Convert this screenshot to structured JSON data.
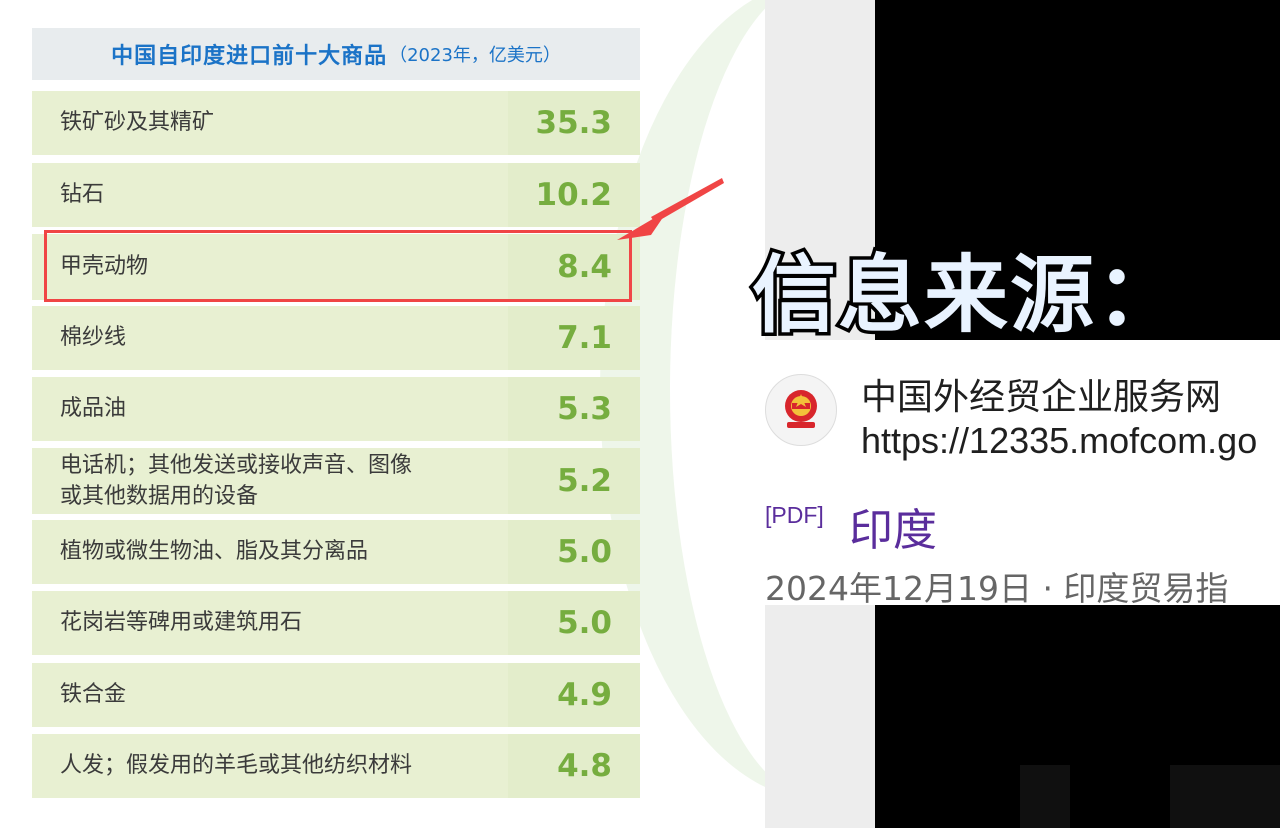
{
  "table": {
    "title": "中国自印度进口前十大商品",
    "title_note": "（2023年，亿美元）",
    "highlighted_row_index": 2
  },
  "chart_data": {
    "type": "table",
    "title": "中国自印度进口前十大商品",
    "unit_note": "（2023年，亿美元）",
    "rows": [
      {
        "name_lines": [
          "铁矿砂及其精矿"
        ],
        "value": "35.3"
      },
      {
        "name_lines": [
          "钻石"
        ],
        "value": "10.2"
      },
      {
        "name_lines": [
          "甲壳动物"
        ],
        "value": "8.4"
      },
      {
        "name_lines": [
          "棉纱线"
        ],
        "value": "7.1"
      },
      {
        "name_lines": [
          "成品油"
        ],
        "value": "5.3"
      },
      {
        "name_lines": [
          "电话机；其他发送或接收声音、图像",
          "或其他数据用的设备"
        ],
        "value": "5.2"
      },
      {
        "name_lines": [
          "植物或微生物油、脂及其分离品"
        ],
        "value": "5.0"
      },
      {
        "name_lines": [
          "花岗岩等碑用或建筑用石"
        ],
        "value": "5.0"
      },
      {
        "name_lines": [
          "铁合金"
        ],
        "value": "4.9"
      },
      {
        "name_lines": [
          "人发；假发用的羊毛或其他纺织材料"
        ],
        "value": "4.8"
      }
    ]
  },
  "source": {
    "heading": "信息来源：",
    "site_name": "中国外经贸企业服务网",
    "site_url": "https://12335.mofcom.go",
    "pdf_tag": "[PDF]",
    "result_title": "印度",
    "snippet": "2024年12月19日 · 印度贸易指"
  },
  "colors": {
    "title_blue": "#1b73c7",
    "value_green": "#76ad3f",
    "row_bg": "#e8f0d2",
    "highlight_red": "#f04545",
    "link_purple": "#5a2d9c"
  }
}
